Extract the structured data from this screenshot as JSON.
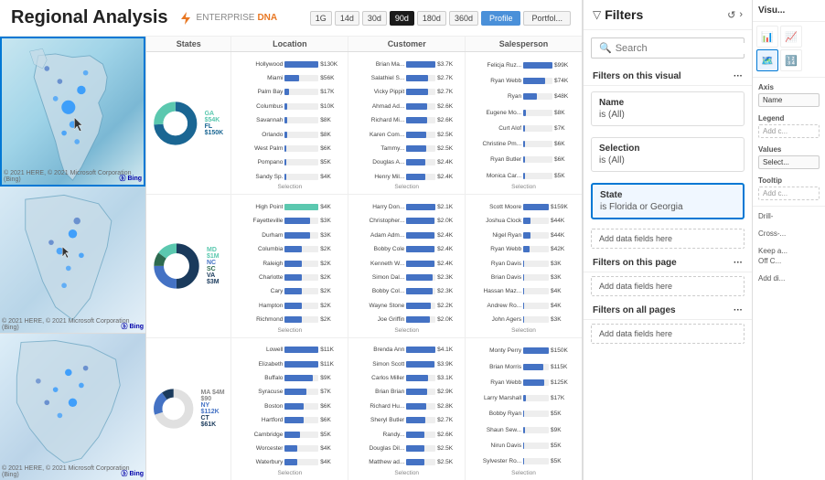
{
  "header": {
    "title": "Regional Analysis",
    "enterprise_label": "ENTERPRISE",
    "dna_label": "DNA",
    "time_buttons": [
      "1G",
      "14d",
      "30d",
      "90d",
      "180d",
      "360d"
    ],
    "active_time": "90d",
    "view_buttons": [
      "Profile",
      "Portfol..."
    ],
    "active_view": "Profile"
  },
  "filters_panel": {
    "title": "Filters",
    "search_placeholder": "Search",
    "sections": [
      {
        "title": "Filters on this visual",
        "filters": [
          {
            "name": "Name",
            "value": "is (All)",
            "highlighted": false
          },
          {
            "name": "Selection",
            "value": "is (All)",
            "highlighted": false
          },
          {
            "name": "State",
            "value": "is Florida or Georgia",
            "highlighted": true
          }
        ],
        "add_label": "Add data fields here"
      },
      {
        "title": "Filters on this page",
        "add_label": "Add data fields here"
      },
      {
        "title": "Filters on all pages",
        "add_label": "Add data fields here"
      }
    ]
  },
  "visual_panel": {
    "title": "Visu...",
    "sections": [
      {
        "title": "Axis",
        "label": "Name"
      },
      {
        "title": "Legend",
        "label": "Add c..."
      },
      {
        "title": "Values",
        "label": "Select..."
      },
      {
        "title": "Tooltip",
        "label": "Add c..."
      },
      {
        "title": "Drill-",
        "label": "Cross-..."
      },
      {
        "title": "Keep a...",
        "label": "Off C..."
      },
      {
        "title": "Add di...",
        "label": ""
      }
    ]
  },
  "rows": [
    {
      "map_region": "Florida/Georgia",
      "states_chart": {
        "donut_segments": [
          {
            "label": "GA $54K",
            "color": "#5bc8af",
            "pct": 26
          },
          {
            "label": "FL $150K",
            "color": "#1a6693",
            "pct": 74
          }
        ]
      },
      "location_bars": [
        {
          "label": "Hollywood",
          "value": "$130K",
          "pct": 100,
          "color": "#4472c4"
        },
        {
          "label": "Miami",
          "value": "$56K",
          "pct": 43,
          "color": "#4472c4"
        },
        {
          "label": "Palm Bay",
          "value": "$17K",
          "pct": 13,
          "color": "#4472c4"
        },
        {
          "label": "Columbus",
          "value": "$10K",
          "pct": 8,
          "color": "#4472c4"
        },
        {
          "label": "Savannah",
          "value": "$8K",
          "pct": 6,
          "color": "#4472c4"
        },
        {
          "label": "Orlando",
          "value": "$8K",
          "pct": 6,
          "color": "#4472c4"
        },
        {
          "label": "West Palm",
          "value": "$6K",
          "pct": 5,
          "color": "#4472c4"
        },
        {
          "label": "Pompano",
          "value": "$5K",
          "pct": 4,
          "color": "#4472c4"
        },
        {
          "label": "Sandy Sp.",
          "value": "$4K",
          "pct": 3,
          "color": "#4472c4"
        }
      ],
      "customer_bars": [
        {
          "label": "Brian Ma...",
          "value": "$3.7K",
          "pct": 100,
          "color": "#4472c4"
        },
        {
          "label": "Salathiel S...",
          "value": "$2.7K",
          "pct": 73,
          "color": "#4472c4"
        },
        {
          "label": "Vicky Pippit",
          "value": "$2.7K",
          "pct": 73,
          "color": "#4472c4"
        },
        {
          "label": "Ahmad Ad...",
          "value": "$2.6K",
          "pct": 70,
          "color": "#4472c4"
        },
        {
          "label": "Richard Mi...",
          "value": "$2.6K",
          "pct": 70,
          "color": "#4472c4"
        },
        {
          "label": "Karen Com...",
          "value": "$2.5K",
          "pct": 68,
          "color": "#4472c4"
        },
        {
          "label": "Tammy...",
          "value": "$2.5K",
          "pct": 68,
          "color": "#4472c4"
        },
        {
          "label": "Douglas A...",
          "value": "$2.4K",
          "pct": 65,
          "color": "#4472c4"
        },
        {
          "label": "Henry Mil...",
          "value": "$2.4K",
          "pct": 65,
          "color": "#4472c4"
        }
      ],
      "salesperson_bars": [
        {
          "label": "Felicja Ruz...",
          "value": "$99K",
          "pct": 100,
          "color": "#4472c4"
        },
        {
          "label": "Ryan Webb",
          "value": "$74K",
          "pct": 75,
          "color": "#4472c4"
        },
        {
          "label": "Ryan",
          "value": "$48K",
          "pct": 48,
          "color": "#4472c4"
        },
        {
          "label": "Eugene Mo...",
          "value": "$8K",
          "pct": 8,
          "color": "#4472c4"
        },
        {
          "label": "Curt Alof",
          "value": "$7K",
          "pct": 7,
          "color": "#4472c4"
        },
        {
          "label": "Christine Pm...",
          "value": "$6K",
          "pct": 6,
          "color": "#4472c4"
        },
        {
          "label": "Ryan Butler",
          "value": "$6K",
          "pct": 6,
          "color": "#4472c4"
        },
        {
          "label": "Monica Car...",
          "value": "$5K",
          "pct": 5,
          "color": "#4472c4"
        }
      ]
    },
    {
      "map_region": "Mid-Atlantic",
      "states_chart": {
        "donut_segments": [
          {
            "label": "MD $1M",
            "color": "#5bc8af",
            "pct": 15
          },
          {
            "label": "NC",
            "color": "#4472c4",
            "pct": 25
          },
          {
            "label": "SC",
            "color": "#2d6a4f",
            "pct": 10
          },
          {
            "label": "VA $3M",
            "color": "#1a3a5c",
            "pct": 50
          }
        ]
      },
      "location_bars": [
        {
          "label": "High Point",
          "value": "$4K",
          "pct": 100,
          "color": "#5bc8af"
        },
        {
          "label": "Fayetteville",
          "value": "$3K",
          "pct": 75,
          "color": "#4472c4"
        },
        {
          "label": "Durham",
          "value": "$3K",
          "pct": 75,
          "color": "#4472c4"
        },
        {
          "label": "Columbia",
          "value": "$2K",
          "pct": 50,
          "color": "#4472c4"
        },
        {
          "label": "Raleigh",
          "value": "$2K",
          "pct": 50,
          "color": "#4472c4"
        },
        {
          "label": "Charlotte",
          "value": "$2K",
          "pct": 50,
          "color": "#4472c4"
        },
        {
          "label": "Cary",
          "value": "$2K",
          "pct": 50,
          "color": "#4472c4"
        },
        {
          "label": "Hampton",
          "value": "$2K",
          "pct": 50,
          "color": "#4472c4"
        },
        {
          "label": "Richmond",
          "value": "$2K",
          "pct": 50,
          "color": "#4472c4"
        }
      ],
      "customer_bars": [
        {
          "label": "Harry Don...",
          "value": "$2.1K",
          "pct": 100,
          "color": "#4472c4"
        },
        {
          "label": "Christopher...",
          "value": "$2K",
          "pct": 95,
          "color": "#4472c4"
        },
        {
          "label": "Adam Adm...",
          "value": "$2.4K",
          "pct": 95,
          "color": "#4472c4"
        },
        {
          "label": "Bobby Cole",
          "value": "$2.4K",
          "pct": 95,
          "color": "#4472c4"
        },
        {
          "label": "Kenneth W...",
          "value": "$2.4K",
          "pct": 95,
          "color": "#4472c4"
        },
        {
          "label": "Simon Dal...",
          "value": "$2.3K",
          "pct": 90,
          "color": "#4472c4"
        },
        {
          "label": "Bobby Col...",
          "value": "$2.3K",
          "pct": 90,
          "color": "#4472c4"
        },
        {
          "label": "Wayne Stone",
          "value": "$2.2K",
          "pct": 85,
          "color": "#4472c4"
        },
        {
          "label": "Joe Griffin",
          "value": "$2.0K",
          "pct": 80,
          "color": "#4472c4"
        }
      ],
      "salesperson_bars": [
        {
          "label": "Scott Moore",
          "value": "$159K",
          "pct": 100,
          "color": "#4472c4"
        },
        {
          "label": "Ryan Webb",
          "value": "$42K",
          "pct": 26,
          "color": "#4472c4"
        },
        {
          "label": "Nigel Ryan",
          "value": "$44K",
          "pct": 28,
          "color": "#4472c4"
        },
        {
          "label": "Joshua Clock",
          "value": "$44K",
          "pct": 28,
          "color": "#4472c4"
        },
        {
          "label": "Ryan Daws",
          "value": "$3K",
          "pct": 2,
          "color": "#4472c4"
        },
        {
          "label": "Brian Davis",
          "value": "$3K",
          "pct": 2,
          "color": "#4472c4"
        },
        {
          "label": "Hassan Maz...",
          "value": "$4K",
          "pct": 3,
          "color": "#4472c4"
        },
        {
          "label": "Andrew Ro...",
          "value": "$4K",
          "pct": 3,
          "color": "#4472c4"
        },
        {
          "label": "John Agers",
          "value": "$3K",
          "pct": 2,
          "color": "#4472c4"
        }
      ]
    },
    {
      "map_region": "New England",
      "states_chart": {
        "donut_segments": [
          {
            "label": "MA $4M $90",
            "color": "#e8e8e8",
            "pct": 70
          },
          {
            "label": "NY $112K",
            "color": "#4472c4",
            "pct": 20
          },
          {
            "label": "CT $61K",
            "color": "#1a3a5c",
            "pct": 10
          }
        ]
      },
      "location_bars": [
        {
          "label": "Lowell",
          "value": "$11K",
          "pct": 100,
          "color": "#4472c4"
        },
        {
          "label": "Elizabeth",
          "value": "$11K",
          "pct": 100,
          "color": "#4472c4"
        },
        {
          "label": "Buffalo",
          "value": "$9K",
          "pct": 82,
          "color": "#4472c4"
        },
        {
          "label": "Syracuse",
          "value": "$7K",
          "pct": 64,
          "color": "#4472c4"
        },
        {
          "label": "Boston",
          "value": "$6K",
          "pct": 55,
          "color": "#4472c4"
        },
        {
          "label": "Hartford",
          "value": "$6K",
          "pct": 55,
          "color": "#4472c4"
        },
        {
          "label": "Cambridge",
          "value": "$5K",
          "pct": 45,
          "color": "#4472c4"
        },
        {
          "label": "Worcester",
          "value": "$4K",
          "pct": 36,
          "color": "#4472c4"
        },
        {
          "label": "Waterbury",
          "value": "$4K",
          "pct": 36,
          "color": "#4472c4"
        }
      ],
      "customer_bars": [
        {
          "label": "Brenda Ann",
          "value": "$4.1K",
          "pct": 100,
          "color": "#4472c4"
        },
        {
          "label": "Simon Scott",
          "value": "$3.9K",
          "pct": 95,
          "color": "#4472c4"
        },
        {
          "label": "Carlos Miller",
          "value": "$3.1K",
          "pct": 76,
          "color": "#4472c4"
        },
        {
          "label": "Brian Brian",
          "value": "$2.9K",
          "pct": 71,
          "color": "#4472c4"
        },
        {
          "label": "Richard Hu...",
          "value": "$2.8K",
          "pct": 68,
          "color": "#4472c4"
        },
        {
          "label": "Sheryl Butler",
          "value": "$2.7K",
          "pct": 66,
          "color": "#4472c4"
        },
        {
          "label": "Randy...",
          "value": "$2.6K",
          "pct": 63,
          "color": "#4472c4"
        },
        {
          "label": "Douglas Dil...",
          "value": "$2.5K",
          "pct": 61,
          "color": "#4472c4"
        },
        {
          "label": "Matthew ad...",
          "value": "$2.5K",
          "pct": 61,
          "color": "#4472c4"
        }
      ],
      "salesperson_bars": [
        {
          "label": "Ryan Webb",
          "value": "$125K",
          "pct": 100,
          "color": "#4472c4"
        },
        {
          "label": "Brian Morris",
          "value": "$115K",
          "pct": 92,
          "color": "#4472c4"
        },
        {
          "label": "Monty Perry",
          "value": "$150K",
          "pct": 100,
          "color": "#4472c4"
        },
        {
          "label": "Larry Marshall",
          "value": "$17K",
          "pct": 14,
          "color": "#4472c4"
        },
        {
          "label": "Bobby Ryan",
          "value": "$5K",
          "pct": 4,
          "color": "#4472c4"
        },
        {
          "label": "Shaun Sew...",
          "value": "$9K",
          "pct": 7,
          "color": "#4472c4"
        },
        {
          "label": "Nirun Davis",
          "value": "$5K",
          "pct": 4,
          "color": "#4472c4"
        },
        {
          "label": "Sylvester Ro...",
          "value": "$5K",
          "pct": 4,
          "color": "#4472c4"
        }
      ]
    }
  ]
}
